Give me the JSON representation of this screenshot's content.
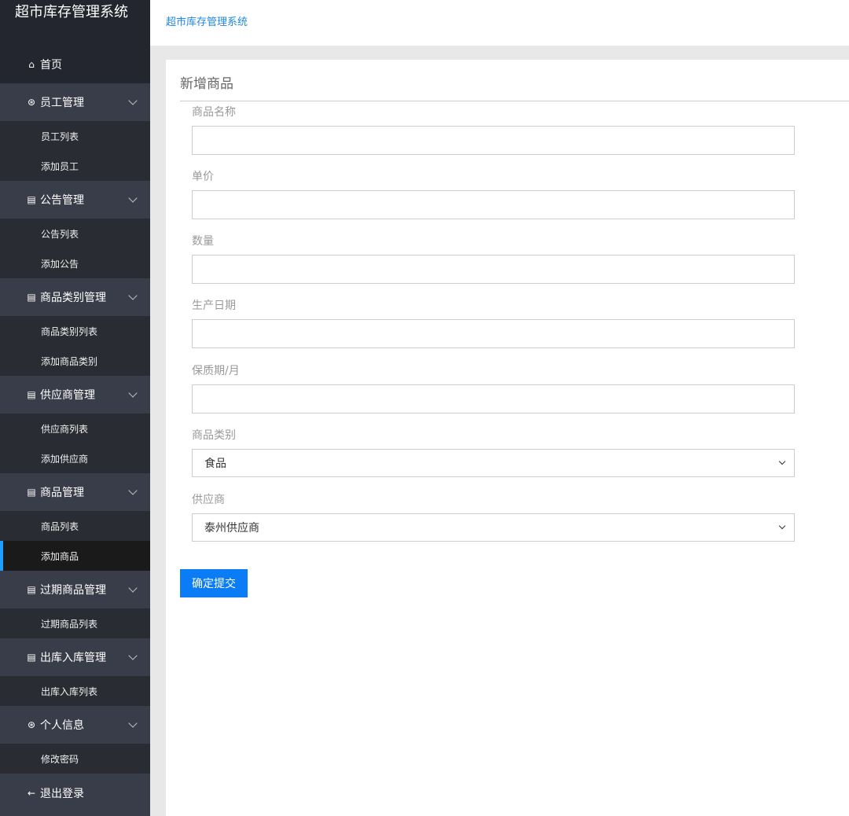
{
  "app_title": "超市库存管理系统",
  "breadcrumb": "超市库存管理系统",
  "sidebar": {
    "home": {
      "icon": "⌂",
      "label": "首页"
    },
    "logout": {
      "icon": "←",
      "label": "退出登录"
    },
    "groups": [
      {
        "icon": "⊛",
        "label": "员工管理",
        "items": [
          "员工列表",
          "添加员工"
        ]
      },
      {
        "icon": "▤",
        "label": "公告管理",
        "items": [
          "公告列表",
          "添加公告"
        ]
      },
      {
        "icon": "▤",
        "label": "商品类别管理",
        "items": [
          "商品类别列表",
          "添加商品类别"
        ]
      },
      {
        "icon": "▤",
        "label": "供应商管理",
        "items": [
          "供应商列表",
          "添加供应商"
        ]
      },
      {
        "icon": "▤",
        "label": "商品管理",
        "items": [
          "商品列表",
          "添加商品"
        ]
      },
      {
        "icon": "▤",
        "label": "过期商品管理",
        "items": [
          "过期商品列表"
        ]
      },
      {
        "icon": "▤",
        "label": "出库入库管理",
        "items": [
          "出库入库列表"
        ]
      },
      {
        "icon": "⊛",
        "label": "个人信息",
        "items": [
          "修改密码"
        ]
      }
    ]
  },
  "form": {
    "title": "新增商品",
    "fields": [
      {
        "label": "商品名称",
        "value": ""
      },
      {
        "label": "单价",
        "value": ""
      },
      {
        "label": "数量",
        "value": ""
      },
      {
        "label": "生产日期",
        "value": ""
      },
      {
        "label": "保质期/月",
        "value": ""
      }
    ],
    "category": {
      "label": "商品类别",
      "selected": "食品"
    },
    "supplier": {
      "label": "供应商",
      "selected": "泰州供应商"
    },
    "submit_label": "确定提交"
  }
}
